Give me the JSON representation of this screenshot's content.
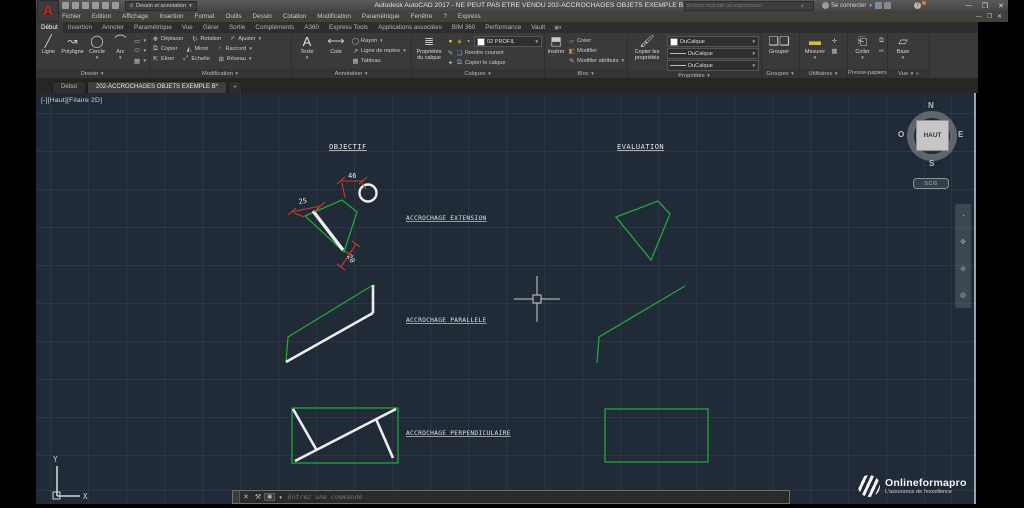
{
  "titlebar": {
    "workspace": "Dessin et annotation",
    "title": "Autodesk AutoCAD 2017 - NE PEUT PAS ETRE VENDU    202-ACCROCHAGES OBJETS EXEMPLE B.dwg",
    "search_placeholder": "Entrez mot-clé ou expression",
    "signin": "Se connecter"
  },
  "menubar": {
    "items": [
      "Fichier",
      "Edition",
      "Affichage",
      "Insertion",
      "Format",
      "Outils",
      "Dessin",
      "Cotation",
      "Modification",
      "Paramétrique",
      "Fenêtre",
      "?",
      "Express"
    ]
  },
  "ribbon": {
    "tabs": [
      "Début",
      "Insertion",
      "Annoter",
      "Paramétrique",
      "Vue",
      "Gérer",
      "Sortie",
      "Compléments",
      "A360",
      "Express Tools",
      "Applications associées",
      "BIM 360",
      "Performance",
      "Vault"
    ],
    "active_tab": "Début",
    "dessin": {
      "label": "Dessin",
      "buttons": [
        "Ligne",
        "Polyligne",
        "Cercle",
        "Arc"
      ]
    },
    "modification": {
      "label": "Modification",
      "items": [
        "Déplacer",
        "Rotation",
        "Ajuster",
        "Copier",
        "Miroir",
        "Raccord",
        "Etirer",
        "Echelle",
        "Réseau"
      ]
    },
    "annotation": {
      "label": "Annotation",
      "big": [
        "Texte",
        "Cote"
      ],
      "small": [
        "Rayon",
        "Ligne de repère",
        "Tableau"
      ]
    },
    "calques": {
      "label": "Calques",
      "big": "Propriétés du calque",
      "layer": "02 PROFIL",
      "items": [
        "Rendre courant",
        "Copier le calque"
      ]
    },
    "bloc": {
      "label": "Bloc",
      "big": "Insérer",
      "small": [
        "Créer",
        "Modifier",
        "Modifier attributs"
      ]
    },
    "proprietes": {
      "label": "Propriétés",
      "big": "Copier les propriétés",
      "dropdowns": [
        "DuCalque",
        "DuCalque",
        "DuCalque"
      ]
    },
    "groupes": {
      "label": "Groupes",
      "big": "Grouper"
    },
    "utilitaires": {
      "label": "Utilitaires",
      "big": "Mesurer"
    },
    "pressepapiers": {
      "label": "Presse-papiers",
      "big": "Coller"
    },
    "vue": {
      "label": "Vue",
      "big": "Base"
    }
  },
  "filetabs": {
    "tabs": [
      "Début",
      "202-ACCROCHAGES OBJETS EXEMPLE B*"
    ],
    "add": "+"
  },
  "viewport": {
    "controls": "[-][Haut][Filaire 2D]"
  },
  "viewcube": {
    "n": "N",
    "s": "S",
    "e": "E",
    "o": "O",
    "face": "HAUT",
    "badge": "SCG"
  },
  "canvas": {
    "labels": {
      "objectif": "OBJECTIF",
      "evaluation": "EVALUATION",
      "extension": "ACCROCHAGE EXTENSION",
      "parallele": "ACCROCHAGE PARALLELE",
      "perpendiculaire": "ACCROCHAGE PERPENDICULAIRE"
    },
    "dimensions": {
      "d46": "46",
      "d25": "25",
      "d20": "20"
    },
    "axis": {
      "x": "X",
      "y": "Y"
    },
    "colors": {
      "background": "#202b37",
      "grid": "#2c3a4a",
      "entity_green": "#23a63d",
      "entity_white": "#ededed",
      "dimension_red": "#cf3a2c"
    }
  },
  "commandline": {
    "prompt": "Entrez une commande"
  },
  "watermark": {
    "brand": "Onlineformapro",
    "tagline": "L'assurance de l'excellence"
  }
}
